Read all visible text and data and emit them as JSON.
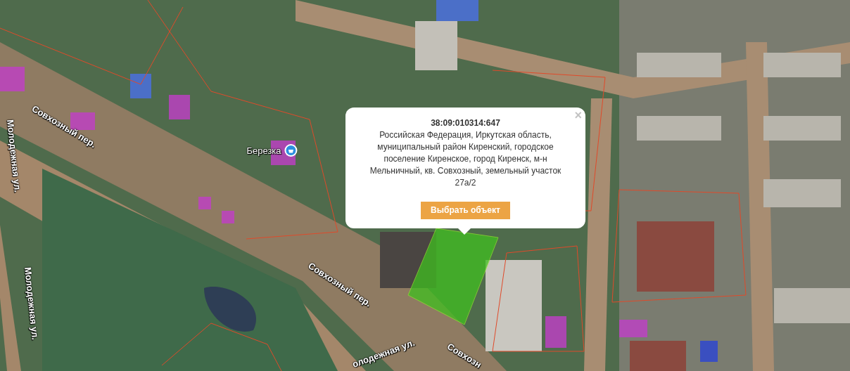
{
  "map_labels": [
    {
      "kind": "street",
      "text": "Совхозный пер."
    },
    {
      "kind": "street",
      "text": "Молодежная ул."
    },
    {
      "kind": "street",
      "text": "Молодежная ул."
    },
    {
      "kind": "poi",
      "text": "Березка"
    },
    {
      "kind": "street",
      "text": "Совхозный пер."
    },
    {
      "kind": "street",
      "text": "олодежная ул."
    },
    {
      "kind": "street",
      "text": "Совхозн"
    }
  ],
  "popup": {
    "title": "38:09:010314:647",
    "address": "Российская Федерация, Иркутская область, муниципальный район Киренский, городское поселение Киренское, город Киренск, м-н Мельничный, кв. Совхозный, земельный участок 27а/2",
    "close": "×",
    "button": "Выбрать объект"
  }
}
